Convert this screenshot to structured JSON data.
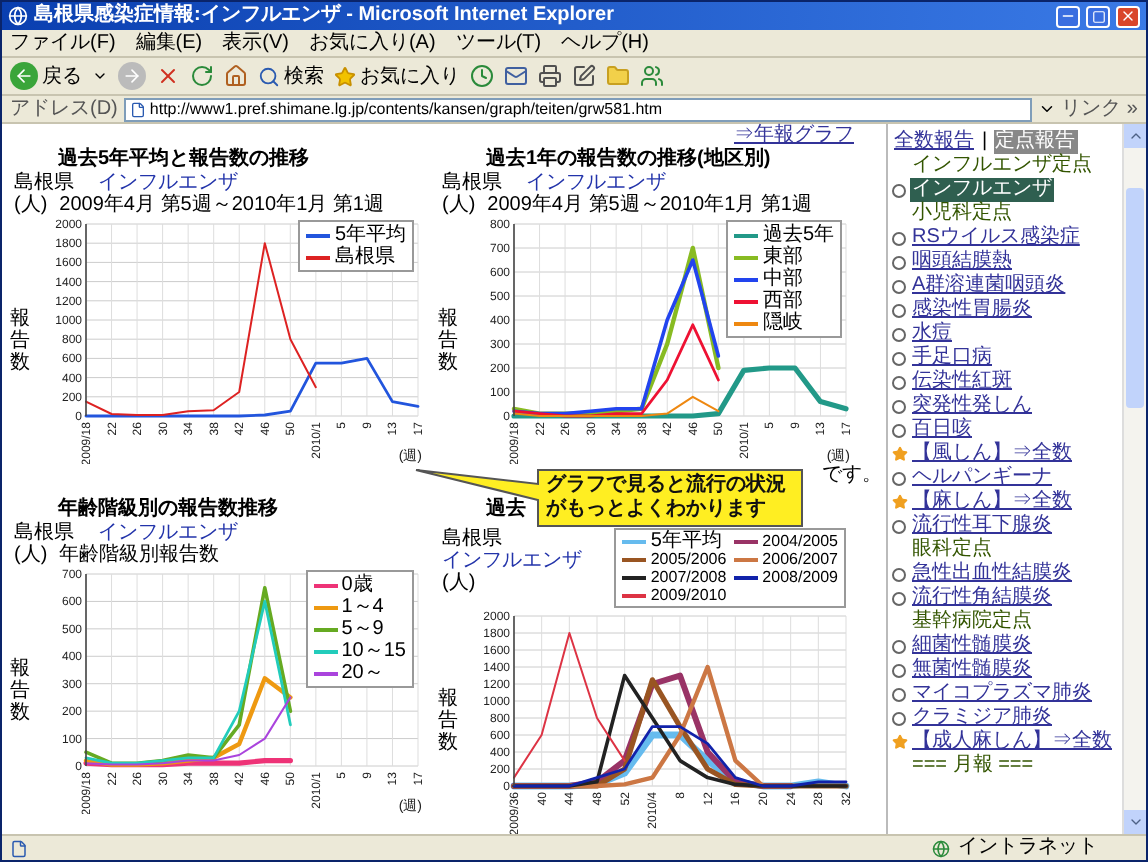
{
  "window": {
    "title": "島根県感染症情報:インフルエンザ - Microsoft Internet Explorer"
  },
  "menu": [
    "ファイル(F)",
    "編集(E)",
    "表示(V)",
    "お気に入り(A)",
    "ツール(T)",
    "ヘルプ(H)"
  ],
  "toolbar": {
    "back": "戻る",
    "search": "検索",
    "favorites": "お気に入り"
  },
  "address": {
    "label": "アドレス(D)",
    "value": "http://www1.pref.shimane.lg.jp/contents/kansen/graph/teiten/grw581.htm",
    "links": "リンク »"
  },
  "page": {
    "annual_link": "⇒年報グラフ",
    "note": "です。",
    "callout": "グラフで見ると流行の状況がもっとよくわかります",
    "charts": [
      {
        "region": "島根県",
        "disease": "インフルエンザ",
        "period": "2009年4月 第5週～2010年1月 第1週",
        "unit": "(人)",
        "chart_data": {
          "type": "line",
          "grid": true,
          "title": "過去5年平均と報告数の推移",
          "xlabel": "(週)",
          "ylabel": "報告数",
          "categories": [
            "2009/18",
            "22",
            "26",
            "30",
            "34",
            "38",
            "42",
            "46",
            "50",
            "2010/1",
            "5",
            "9",
            "13",
            "17"
          ],
          "ylim": [
            0,
            2000
          ],
          "yticks": [
            0,
            200,
            400,
            600,
            800,
            1000,
            1200,
            1400,
            1600,
            1800,
            2000
          ],
          "series": [
            {
              "name": "5年平均",
              "color": "#2255dd",
              "values": [
                0,
                0,
                0,
                0,
                0,
                0,
                0,
                10,
                50,
                550,
                550,
                600,
                150,
                100
              ]
            },
            {
              "name": "島根県",
              "color": "#dd2222",
              "values": [
                150,
                20,
                10,
                10,
                50,
                60,
                250,
                1800,
                800,
                300,
                null,
                null,
                null,
                null
              ]
            }
          ]
        }
      },
      {
        "region": "島根県",
        "disease": "インフルエンザ",
        "period": "2009年4月 第5週～2010年1月 第1週",
        "unit": "(人)",
        "chart_data": {
          "type": "line",
          "grid": true,
          "title": "過去1年の報告数の推移(地区別)",
          "xlabel": "(週)",
          "ylabel": "報告数",
          "categories": [
            "2009/18",
            "22",
            "26",
            "30",
            "34",
            "38",
            "42",
            "46",
            "50",
            "2010/1",
            "5",
            "9",
            "13",
            "17"
          ],
          "ylim": [
            0,
            800
          ],
          "yticks": [
            0,
            100,
            200,
            300,
            400,
            500,
            600,
            700,
            800
          ],
          "series": [
            {
              "name": "過去5年",
              "color": "#229988",
              "values": [
                0,
                0,
                0,
                0,
                0,
                0,
                0,
                0,
                10,
                190,
                200,
                200,
                60,
                30
              ]
            },
            {
              "name": "東部",
              "color": "#88bb22",
              "values": [
                30,
                10,
                10,
                10,
                20,
                30,
                300,
                700,
                200,
                null,
                null,
                null,
                null,
                null
              ]
            },
            {
              "name": "中部",
              "color": "#2244ee",
              "values": [
                20,
                10,
                10,
                20,
                30,
                30,
                400,
                650,
                250,
                null,
                null,
                null,
                null,
                null
              ]
            },
            {
              "name": "西部",
              "color": "#ee1133",
              "values": [
                20,
                10,
                0,
                0,
                10,
                10,
                150,
                380,
                150,
                null,
                null,
                null,
                null,
                null
              ]
            },
            {
              "name": "隠岐",
              "color": "#ee8811",
              "values": [
                10,
                0,
                0,
                0,
                0,
                0,
                10,
                80,
                20,
                null,
                null,
                null,
                null,
                null
              ]
            }
          ]
        }
      },
      {
        "region": "島根県",
        "disease": "インフルエンザ",
        "subtitle": "年齢階級別報告数",
        "unit": "(人)",
        "chart_data": {
          "type": "line",
          "grid": true,
          "title": "年齢階級別の報告数推移",
          "xlabel": "(週)",
          "ylabel": "報告数",
          "categories": [
            "2009/18",
            "22",
            "26",
            "30",
            "34",
            "38",
            "42",
            "46",
            "50",
            "2010/1",
            "5",
            "9",
            "13",
            "17"
          ],
          "ylim": [
            0,
            700
          ],
          "yticks": [
            0,
            100,
            200,
            300,
            400,
            500,
            600,
            700
          ],
          "series": [
            {
              "name": "0歳",
              "color": "#ee3377",
              "values": [
                10,
                5,
                5,
                5,
                10,
                10,
                10,
                20,
                20,
                null,
                null,
                null,
                null,
                null
              ]
            },
            {
              "name": "1～4",
              "color": "#ee9911",
              "values": [
                20,
                5,
                5,
                10,
                20,
                30,
                80,
                320,
                250,
                null,
                null,
                null,
                null,
                null
              ]
            },
            {
              "name": "5～9",
              "color": "#66aa22",
              "values": [
                50,
                10,
                10,
                20,
                40,
                30,
                150,
                650,
                200,
                null,
                null,
                null,
                null,
                null
              ]
            },
            {
              "name": "10～15",
              "color": "#22ccbb",
              "values": [
                30,
                10,
                10,
                20,
                30,
                30,
                200,
                600,
                150,
                null,
                null,
                null,
                null,
                null
              ]
            },
            {
              "name": "20～",
              "color": "#aa44dd",
              "values": [
                10,
                5,
                5,
                10,
                20,
                20,
                40,
                100,
                250,
                null,
                null,
                null,
                null,
                null
              ]
            }
          ]
        }
      },
      {
        "region": "島根県",
        "disease": "インフルエンザ",
        "unit": "(人)",
        "chart_data": {
          "type": "line",
          "grid": true,
          "title": "過去",
          "ylabel": "報告数",
          "categories": [
            "2009/36",
            "40",
            "44",
            "48",
            "52",
            "2010/4",
            "8",
            "12",
            "16",
            "20",
            "24",
            "28",
            "32"
          ],
          "ylim": [
            0,
            2000
          ],
          "yticks": [
            0,
            200,
            400,
            600,
            800,
            1000,
            1200,
            1400,
            1600,
            1800,
            2000
          ],
          "series": [
            {
              "name": "5年平均",
              "color": "#66bbee",
              "values": [
                0,
                0,
                0,
                20,
                150,
                600,
                600,
                300,
                50,
                0,
                0,
                50,
                0
              ]
            },
            {
              "name": "2004/2005",
              "color": "#993366",
              "values": [
                0,
                0,
                0,
                50,
                300,
                1200,
                1300,
                400,
                50,
                0,
                0,
                null,
                null
              ]
            },
            {
              "name": "2005/2006",
              "color": "#995522",
              "values": [
                0,
                0,
                0,
                0,
                200,
                1250,
                700,
                200,
                20,
                0,
                0,
                0,
                0
              ]
            },
            {
              "name": "2006/2007",
              "color": "#cc7744",
              "values": [
                0,
                0,
                0,
                0,
                20,
                100,
                600,
                1400,
                300,
                0,
                0,
                null,
                null
              ]
            },
            {
              "name": "2007/2008",
              "color": "#222222",
              "values": [
                0,
                0,
                0,
                50,
                1300,
                800,
                300,
                100,
                20,
                0,
                0,
                0,
                0
              ]
            },
            {
              "name": "2008/2009",
              "color": "#1122aa",
              "values": [
                0,
                0,
                0,
                100,
                200,
                700,
                700,
                500,
                100,
                0,
                0,
                50,
                50
              ]
            },
            {
              "name": "2009/2010",
              "color": "#dd3344",
              "values": [
                100,
                600,
                1800,
                800,
                300,
                null,
                null,
                null,
                null,
                null,
                null,
                null,
                null
              ]
            }
          ]
        }
      }
    ]
  },
  "sidebar": {
    "tabs": [
      {
        "label": "全数報告",
        "selected": false
      },
      {
        "label": "定点報告",
        "selected": true
      }
    ],
    "tab_separator": "|",
    "items": [
      {
        "kind": "heading",
        "label": "インフルエンザ定点"
      },
      {
        "kind": "radio",
        "label": "インフルエンザ",
        "selected": true
      },
      {
        "kind": "heading",
        "label": "小児科定点"
      },
      {
        "kind": "radio",
        "label": "RSウイルス感染症",
        "selected": false
      },
      {
        "kind": "radio",
        "label": "咽頭結膜熱",
        "selected": false
      },
      {
        "kind": "radio",
        "label": "A群溶連菌咽頭炎",
        "selected": false
      },
      {
        "kind": "radio",
        "label": "感染性胃腸炎",
        "selected": false
      },
      {
        "kind": "radio",
        "label": "水痘",
        "selected": false
      },
      {
        "kind": "radio",
        "label": "手足口病",
        "selected": false
      },
      {
        "kind": "radio",
        "label": "伝染性紅斑",
        "selected": false
      },
      {
        "kind": "radio",
        "label": "突発性発しん",
        "selected": false
      },
      {
        "kind": "radio",
        "label": "百日咳",
        "selected": false
      },
      {
        "kind": "star",
        "label": "【風しん】⇒全数",
        "selected": false
      },
      {
        "kind": "radio",
        "label": "ヘルパンギーナ",
        "selected": false
      },
      {
        "kind": "star",
        "label": "【麻しん】⇒全数",
        "selected": false
      },
      {
        "kind": "radio",
        "label": "流行性耳下腺炎",
        "selected": false
      },
      {
        "kind": "heading",
        "label": "眼科定点"
      },
      {
        "kind": "radio",
        "label": "急性出血性結膜炎",
        "selected": false
      },
      {
        "kind": "radio",
        "label": "流行性角結膜炎",
        "selected": false
      },
      {
        "kind": "heading",
        "label": "基幹病院定点"
      },
      {
        "kind": "radio",
        "label": "細菌性髄膜炎",
        "selected": false
      },
      {
        "kind": "radio",
        "label": "無菌性髄膜炎",
        "selected": false
      },
      {
        "kind": "radio",
        "label": "マイコプラズマ肺炎",
        "selected": false
      },
      {
        "kind": "radio",
        "label": "クラミジア肺炎",
        "selected": false
      },
      {
        "kind": "star",
        "label": "【成人麻しん】⇒全数",
        "selected": false
      },
      {
        "kind": "section",
        "label": "=== 月報 ==="
      }
    ]
  },
  "status_bar": {
    "zone": "イントラネット"
  }
}
